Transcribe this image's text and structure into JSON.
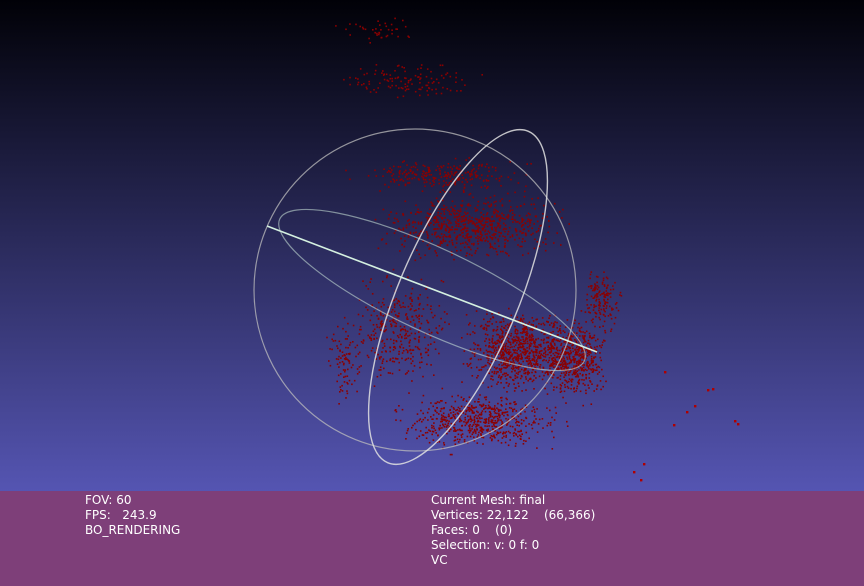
{
  "viewport": {
    "background_top": "#010107",
    "background_bottom": "#6565d3",
    "point_color": "#8b0000",
    "trackball_color": "#c8c8c8",
    "trackball_axis_color": "#c8e8d8"
  },
  "info_left": {
    "fov": "FOV: 60",
    "fps": "FPS:   243.9",
    "render_mode": "BO_RENDERING"
  },
  "info_right": {
    "current_mesh": "Current Mesh: final",
    "vertices": "Vertices: 22,122    (66,366)",
    "faces": "Faces: 0    (0)",
    "selection": "Selection: v: 0 f: 0",
    "color_mode": "VC"
  },
  "panel_color": "#7e3f79"
}
